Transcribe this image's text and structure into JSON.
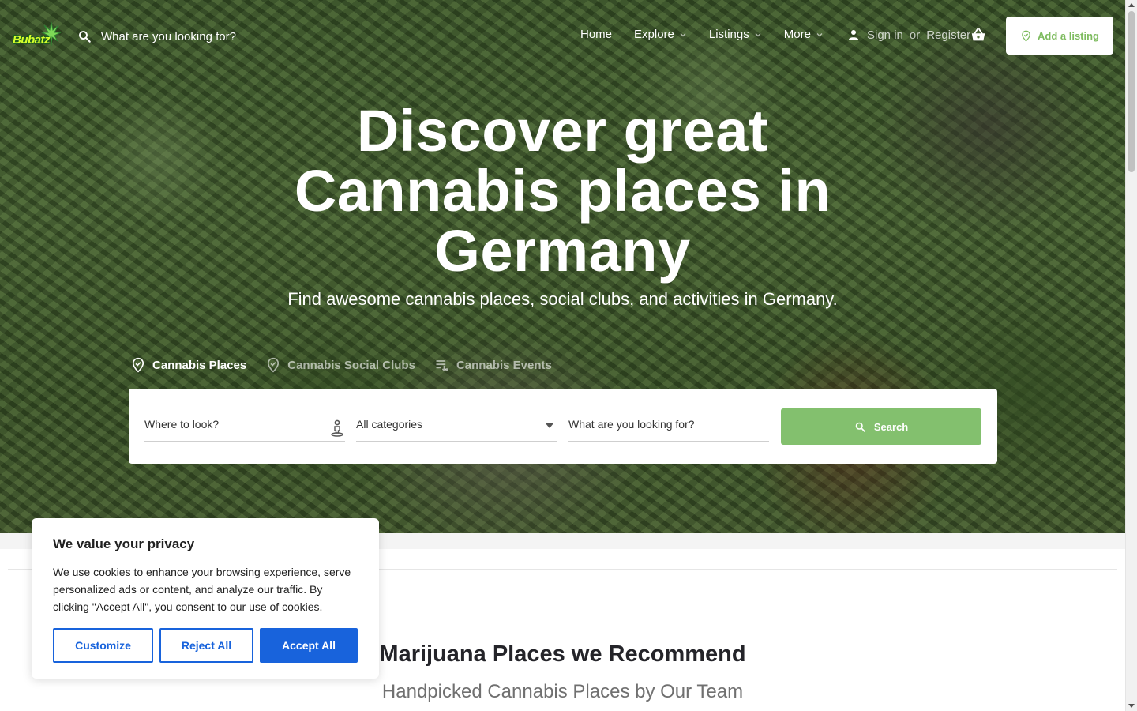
{
  "header": {
    "logo_text": "Bubatz",
    "search_placeholder": "What are you looking for?",
    "nav": [
      {
        "label": "Home"
      },
      {
        "label": "Explore"
      },
      {
        "label": "Listings"
      },
      {
        "label": "More"
      }
    ],
    "sign_in": "Sign in",
    "or": "or",
    "register": "Register",
    "add_listing": "Add a listing"
  },
  "hero": {
    "title_lines": [
      "Discover great",
      "Cannabis places in",
      "Germany"
    ],
    "subtitle": "Find awesome cannabis places, social clubs, and activities in Germany.",
    "tabs": [
      {
        "label": "Cannabis Places",
        "icon": "map-pin-check-icon",
        "active": true
      },
      {
        "label": "Cannabis Social Clubs",
        "icon": "map-pin-check-icon",
        "active": false
      },
      {
        "label": "Cannabis Events",
        "icon": "event-list-icon",
        "active": false
      }
    ],
    "search": {
      "where_placeholder": "Where to look?",
      "category_value": "All categories",
      "what_placeholder": "What are you looking for?",
      "button": "Search"
    }
  },
  "section": {
    "title": "Marijuana Places we Recommend",
    "subtitle": "Handpicked Cannabis Places by Our Team"
  },
  "cookie": {
    "title": "We value your privacy",
    "text": "We use cookies to enhance your browsing experience, serve personalized ads or content, and analyze our traffic. By clicking \"Accept All\", you consent to our use of cookies.",
    "customize": "Customize",
    "reject": "Reject All",
    "accept": "Accept All"
  },
  "colors": {
    "accent_green": "#83c06e",
    "cookie_blue": "#1863dc"
  }
}
